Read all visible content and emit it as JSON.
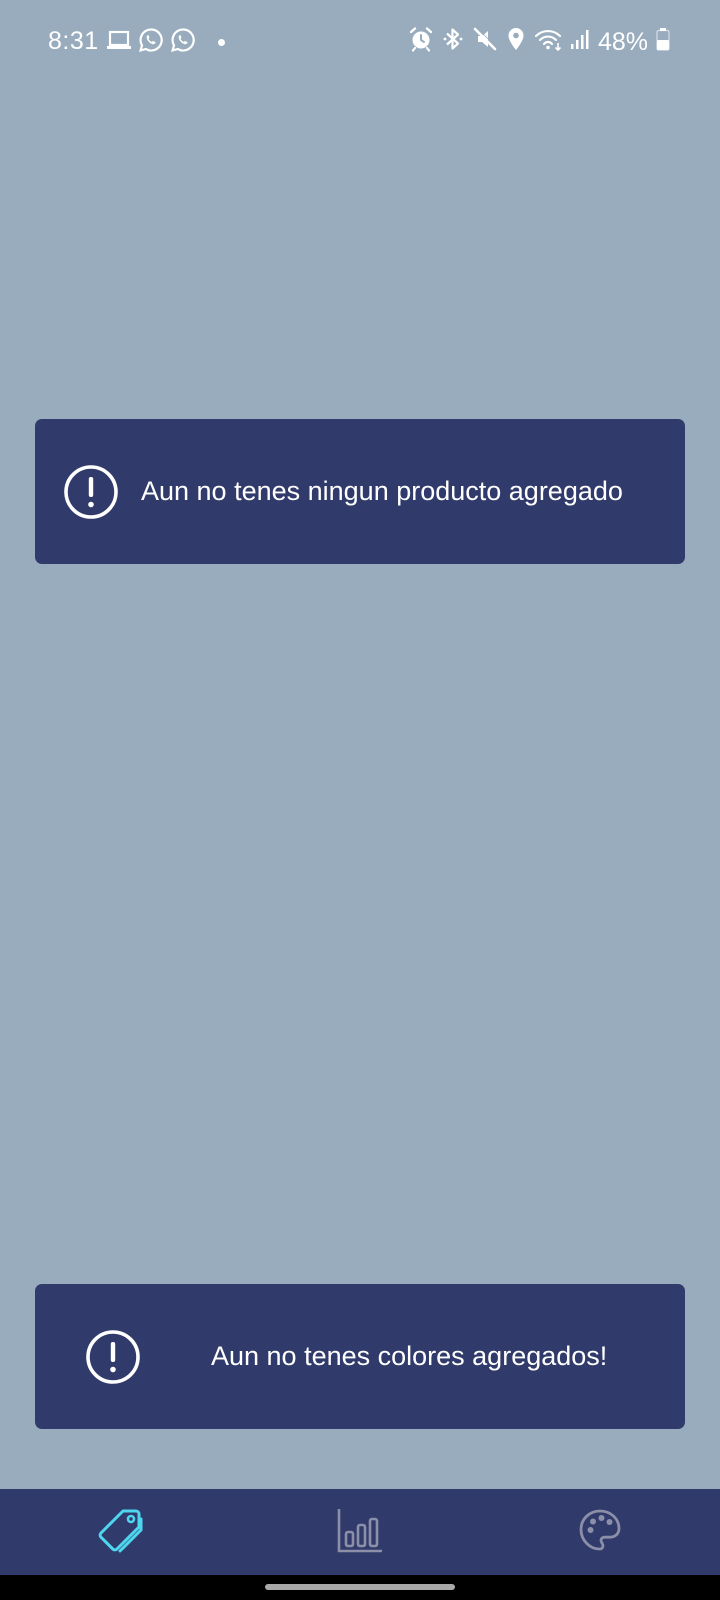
{
  "status_bar": {
    "time": "8:31",
    "battery": "48%",
    "left_icons": [
      "laptop-icon",
      "whatsapp-icon",
      "whatsapp-icon",
      "notification-dot"
    ],
    "right_icons": [
      "alarm-icon",
      "bluetooth-icon",
      "mute-icon",
      "location-icon",
      "wifi-icon",
      "signal-icon",
      "battery-icon"
    ]
  },
  "cards": {
    "products_empty": {
      "message": "Aun no tenes ningun producto agregado",
      "icon": "alert-circle-icon"
    },
    "colors_empty": {
      "message": "Aun no tenes colores agregados!",
      "icon": "alert-circle-icon"
    }
  },
  "bottom_nav": {
    "items": [
      {
        "icon": "price-tag-icon",
        "active": true
      },
      {
        "icon": "bar-chart-icon",
        "active": false
      },
      {
        "icon": "palette-icon",
        "active": false
      }
    ]
  },
  "colors": {
    "background": "#98acbd",
    "card": "#313b6b",
    "nav": "#313b6b",
    "active_icon": "#4fd6ef",
    "inactive_icon": "#8b8fa8"
  }
}
